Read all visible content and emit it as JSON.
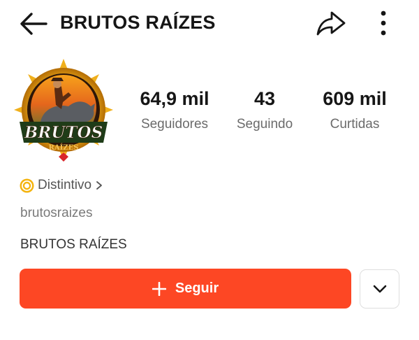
{
  "header": {
    "title": "BRUTOS RAÍZES",
    "back_icon": "arrow-left-icon",
    "share_icon": "share-icon",
    "more_icon": "more-vertical-icon"
  },
  "profile": {
    "avatar_text_line1": "BRUTOS",
    "avatar_text_line2": "RAÍZES",
    "stats": [
      {
        "value": "64,9 mil",
        "label": "Seguidores"
      },
      {
        "value": "43",
        "label": "Seguindo"
      },
      {
        "value": "609 mil",
        "label": "Curtidas"
      }
    ],
    "badge": {
      "label": "Distintivo",
      "icon": "coin-badge-icon"
    },
    "username": "brutosraizes",
    "bio": "BRUTOS RAÍZES"
  },
  "actions": {
    "follow_label": "Seguir",
    "follow_color": "#fd4724",
    "dropdown_icon": "chevron-down-icon"
  }
}
